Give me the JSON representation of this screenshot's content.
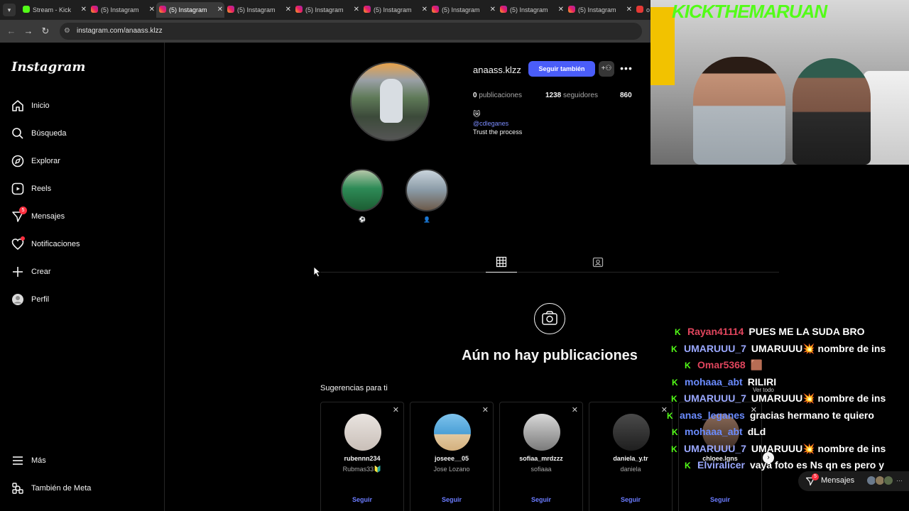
{
  "browser": {
    "tabs": [
      {
        "title": "Stream - Kick",
        "icon": "kick"
      },
      {
        "title": "(5) Instagram",
        "icon": "instagram"
      },
      {
        "title": "(5) Instagram",
        "icon": "instagram",
        "active": true
      },
      {
        "title": "(5) Instagram",
        "icon": "instagram"
      },
      {
        "title": "(5) Instagram",
        "icon": "instagram"
      },
      {
        "title": "(5) Instagram",
        "icon": "instagram"
      },
      {
        "title": "(5) Instagram",
        "icon": "instagram"
      },
      {
        "title": "(5) Instagram",
        "icon": "instagram"
      },
      {
        "title": "(5) Instagram",
        "icon": "instagram"
      },
      {
        "title": "o",
        "icon": "youtube"
      }
    ],
    "url": "instagram.com/anaass.klzz"
  },
  "sidebar": {
    "logo": "Instagram",
    "items": [
      {
        "label": "Inicio",
        "icon": "home-icon"
      },
      {
        "label": "Búsqueda",
        "icon": "search-icon"
      },
      {
        "label": "Explorar",
        "icon": "compass-icon"
      },
      {
        "label": "Reels",
        "icon": "reels-icon"
      },
      {
        "label": "Mensajes",
        "icon": "messenger-icon",
        "badge": "5"
      },
      {
        "label": "Notificaciones",
        "icon": "heart-icon"
      },
      {
        "label": "Crear",
        "icon": "plus-icon"
      },
      {
        "label": "Perfil",
        "icon": "profile-icon"
      }
    ],
    "more": "Más",
    "meta": "También de Meta"
  },
  "profile": {
    "username": "anaass.klzz",
    "follow_label": "Seguir también",
    "stats": {
      "posts_count": "0",
      "posts_label": "publicaciones",
      "followers_count": "1238",
      "followers_label": "seguidores",
      "following_count": "860"
    },
    "bio_emoji": "😿",
    "bio_link": "@cdleganes",
    "bio_text": "Trust the process",
    "highlights": [
      {
        "label": "⚽"
      },
      {
        "label": "👤"
      }
    ],
    "empty_title": "Aún no hay publicaciones",
    "suggestions_heading": "Sugerencias para ti",
    "suggestions": [
      {
        "username": "rubennn234",
        "name": "Rubmas33🔰",
        "button": "Seguir"
      },
      {
        "username": "joseee__05",
        "name": "Jose Lozano",
        "button": "Seguir"
      },
      {
        "username": "sofiaa_mrdzzz",
        "name": "sofiaaa",
        "button": "Seguir"
      },
      {
        "username": "daniela_y.tr",
        "name": "daniela",
        "button": "Seguir"
      },
      {
        "username": "chloee.lgns",
        "name": "",
        "button": "Seguir"
      }
    ]
  },
  "overlay": {
    "stream_title": "KICKTHEMARUAN",
    "ver_todo": "Ver todo",
    "chat": [
      {
        "user": "Rayan41114",
        "msg": "PUES ME LA SUDA BRO",
        "color": "#e0455d"
      },
      {
        "user": "UMARUUU_7",
        "msg": "UMARUUU💥 nombre de ins",
        "color": "#9aa8ff"
      },
      {
        "user": "Omar5368",
        "msg": "🟫",
        "color": "#e0455d"
      },
      {
        "user": "mohaaa_abt",
        "msg": "RILIRI",
        "color": "#6b8cff"
      },
      {
        "user": "UMARUUU_7",
        "msg": "UMARUUU💥 nombre de ins",
        "color": "#9aa8ff"
      },
      {
        "user": "anas_leganes",
        "msg": "gracias hermano te quiero",
        "color": "#6b8cff"
      },
      {
        "user": "mohaaa_abt",
        "msg": "dLd",
        "color": "#6b8cff"
      },
      {
        "user": "UMARUUU_7",
        "msg": "UMARUUU💥 nombre de ins",
        "color": "#9aa8ff"
      },
      {
        "user": "Elviralicer",
        "msg": "vaya foto es Ns qn es pero y",
        "color": "#9aa8ff"
      }
    ],
    "messages_label": "Mensajes",
    "messages_badge": "5"
  }
}
